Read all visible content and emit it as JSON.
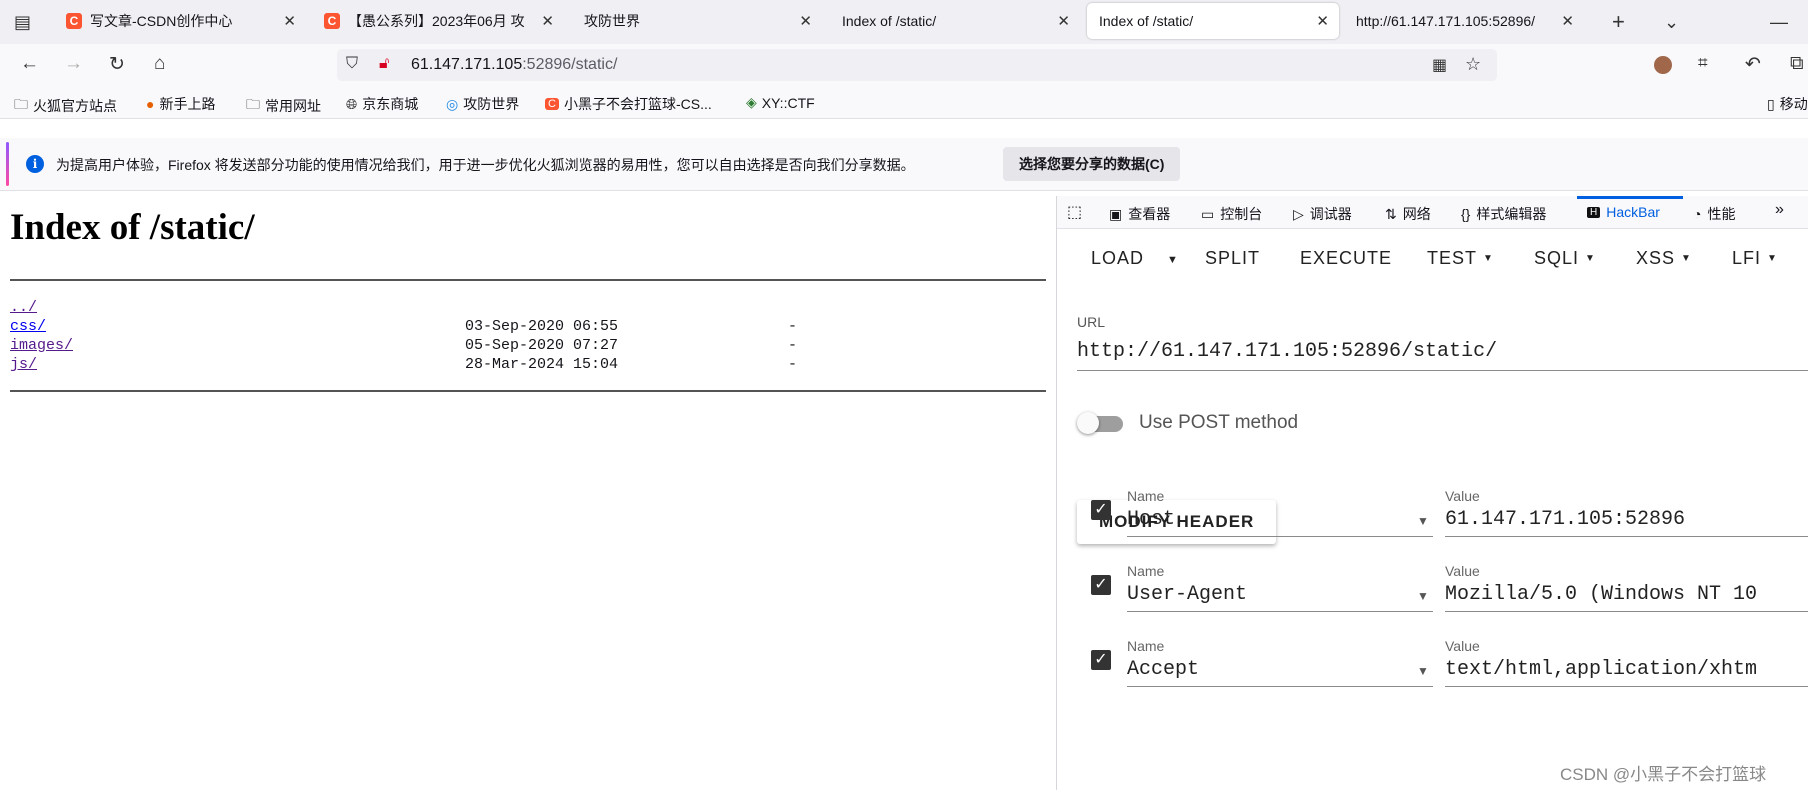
{
  "tabs": [
    {
      "title": "写文章-CSDN创作中心",
      "favicon": "C"
    },
    {
      "title": "【愚公系列】2023年06月 攻",
      "favicon": "C"
    },
    {
      "title": "攻防世界",
      "favicon": ""
    },
    {
      "title": "Index of /static/",
      "favicon": ""
    },
    {
      "title": "Index of /static/",
      "favicon": ""
    },
    {
      "title": "http://61.147.171.105:52896/",
      "favicon": ""
    }
  ],
  "address": {
    "host": "61.147.171.105",
    "rest": ":52896/static/"
  },
  "bookmarks": [
    {
      "label": "火狐官方站点",
      "icon": "folder-icon"
    },
    {
      "label": "新手上路",
      "icon": "firefox-icon"
    },
    {
      "label": "常用网址",
      "icon": "folder-icon"
    },
    {
      "label": "京东商城",
      "icon": "globe-icon"
    },
    {
      "label": "攻防世界",
      "icon": "site-icon"
    },
    {
      "label": "小黑子不会打篮球-CS...",
      "icon": "csdn-icon"
    },
    {
      "label": "XY::CTF",
      "icon": "site-icon"
    },
    {
      "label": "移动",
      "icon": "mobile-icon"
    }
  ],
  "notification": {
    "message": "为提高用户体验，Firefox 将发送部分功能的使用情况给我们，用于进一步优化火狐浏览器的易用性，您可以自由选择是否向我们分享数据。",
    "button": "选择您要分享的数据(C)"
  },
  "page": {
    "heading": "Index of /static/",
    "entries": [
      {
        "name": "../",
        "date": "",
        "size": ""
      },
      {
        "name": "css/",
        "date": "03-Sep-2020 06:55",
        "size": "-"
      },
      {
        "name": "images/",
        "date": "05-Sep-2020 07:27",
        "size": "-"
      },
      {
        "name": "js/",
        "date": "28-Mar-2024 15:04",
        "size": "-"
      }
    ]
  },
  "devtools": {
    "tabs": [
      "查看器",
      "控制台",
      "调试器",
      "网络",
      "样式编辑器",
      "HackBar",
      "性能"
    ],
    "active_tab": "HackBar"
  },
  "hackbar": {
    "toolbar": [
      "LOAD",
      "SPLIT",
      "EXECUTE",
      "TEST",
      "SQLI",
      "XSS",
      "LFI"
    ],
    "url_label": "URL",
    "url_value": "http://61.147.171.105:52896/static/",
    "post_label": "Use POST method",
    "post_enabled": false,
    "modify_header_label": "MODIFY HEADER",
    "headers": [
      {
        "name_label": "Name",
        "name": "Host",
        "value_label": "Value",
        "value": "61.147.171.105:52896",
        "checked": true
      },
      {
        "name_label": "Name",
        "name": "User-Agent",
        "value_label": "Value",
        "value": "Mozilla/5.0 (Windows NT 10",
        "checked": true
      },
      {
        "name_label": "Name",
        "name": "Accept",
        "value_label": "Value",
        "value": "text/html,application/xhtm",
        "checked": true
      }
    ]
  },
  "watermark": "CSDN @小黑子不会打篮球"
}
